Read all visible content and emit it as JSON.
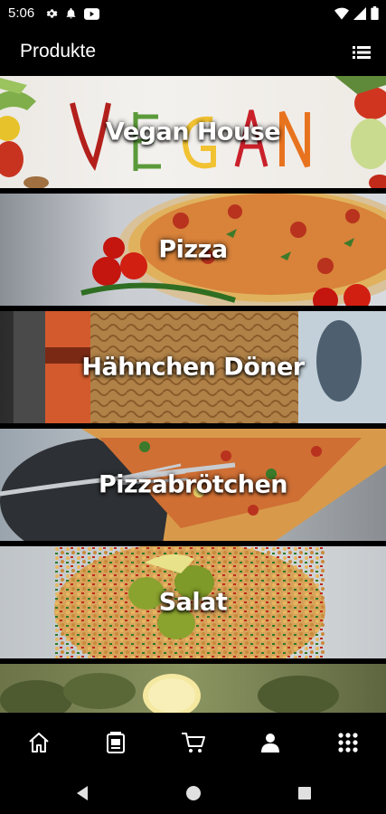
{
  "status_bar": {
    "time": "5:06"
  },
  "app_bar": {
    "title": "Produkte"
  },
  "categories": [
    {
      "label": "Vegan House"
    },
    {
      "label": "Pizza"
    },
    {
      "label": "Hähnchen Döner"
    },
    {
      "label": "Pizzabrötchen"
    },
    {
      "label": "Salat"
    },
    {
      "label": ""
    }
  ],
  "vegan_logo_text": "VEGAN",
  "bottom_nav": {
    "items": [
      {
        "icon": "home-icon"
      },
      {
        "icon": "menu-card-icon"
      },
      {
        "icon": "cart-icon"
      },
      {
        "icon": "person-icon"
      },
      {
        "icon": "grid-icon"
      }
    ]
  },
  "colors": {
    "background": "#000000",
    "text": "#ffffff"
  }
}
